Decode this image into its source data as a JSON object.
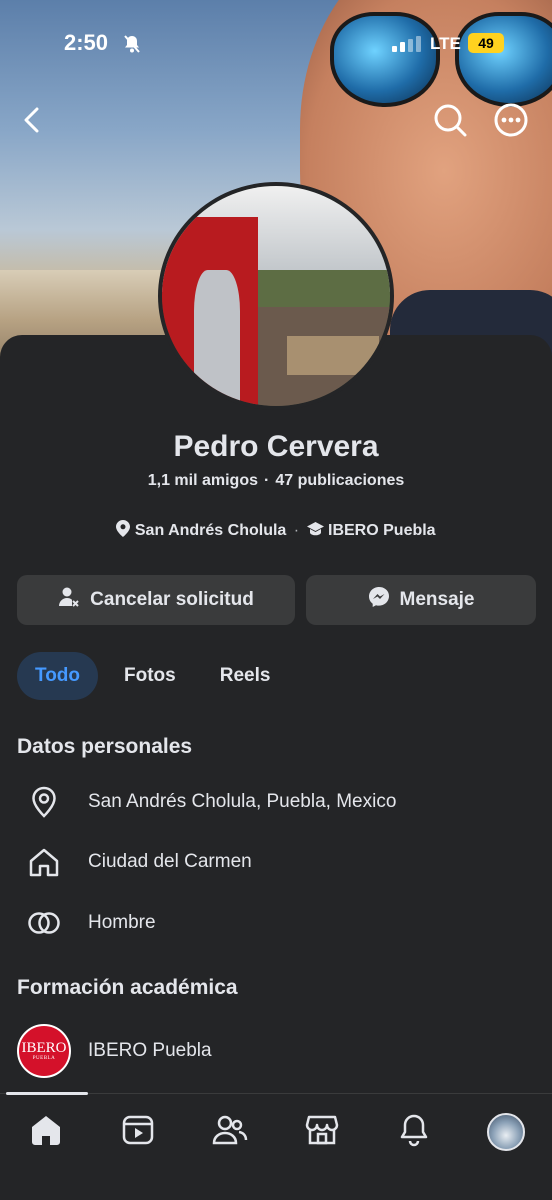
{
  "status_bar": {
    "time": "2:50",
    "network": "LTE",
    "battery": "49"
  },
  "header": {
    "back_icon": "chevron-left-icon",
    "search_icon": "search-icon",
    "more_icon": "more-horizontal-icon"
  },
  "profile": {
    "name": "Pedro Cervera",
    "friends": "1,1 mil amigos",
    "posts": "47 publicaciones",
    "location_short": "San Andrés Cholula",
    "education_short": "IBERO Puebla"
  },
  "actions": {
    "cancel_request": "Cancelar solicitud",
    "message": "Mensaje"
  },
  "tabs": [
    {
      "label": "Todo",
      "active": true
    },
    {
      "label": "Fotos",
      "active": false
    },
    {
      "label": "Reels",
      "active": false
    }
  ],
  "personal": {
    "title": "Datos personales",
    "items": [
      {
        "icon": "location-pin-icon",
        "text": "San Andrés Cholula, Puebla, Mexico"
      },
      {
        "icon": "home-icon",
        "text": "Ciudad del Carmen"
      },
      {
        "icon": "gender-rings-icon",
        "text": "Hombre"
      }
    ]
  },
  "education": {
    "title": "Formación académica",
    "school": "IBERO Puebla",
    "logo_text": "IBERO",
    "logo_sub": "PUEBLA"
  },
  "colors": {
    "background": "#242527",
    "button": "#3a3b3c",
    "active_tab_bg": "#263951",
    "active_tab_text": "#4599ff",
    "battery": "#ffd21f",
    "ibero_red": "#d4112a"
  },
  "navbar": [
    "home-icon",
    "video-icon",
    "friends-icon",
    "marketplace-icon",
    "notifications-icon",
    "profile-avatar"
  ]
}
